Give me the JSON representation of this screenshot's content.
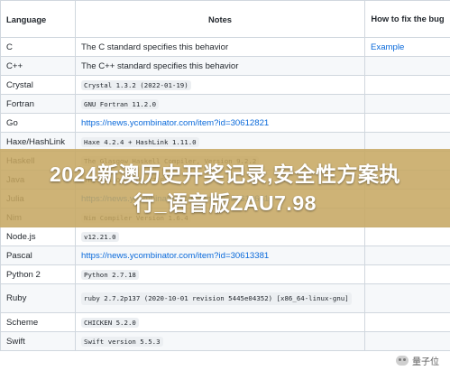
{
  "table": {
    "headers": [
      "Language",
      "Notes",
      "How to fix the bug"
    ],
    "rows": [
      {
        "language": "C",
        "notes": "The C standard specifies this behavior",
        "notes_style": "text",
        "fix": "Example"
      },
      {
        "language": "C++",
        "notes": "The C++ standard specifies this behavior",
        "notes_style": "text",
        "fix": ""
      },
      {
        "language": "Crystal",
        "notes": "Crystal 1.3.2 (2022-01-19)",
        "notes_style": "code",
        "fix": ""
      },
      {
        "language": "Fortran",
        "notes": "GNU Fortran 11.2.0",
        "notes_style": "code",
        "fix": ""
      },
      {
        "language": "Go",
        "notes": "https://news.ycombinator.com/item?id=30612821",
        "notes_style": "link",
        "fix": ""
      },
      {
        "language": "Haxe/HashLink",
        "notes": "Haxe 4.2.4 + HashLink 1.11.0",
        "notes_style": "code",
        "fix": ""
      },
      {
        "language": "Haskell",
        "notes": "The Glasgow Haskell Compiler, Version 9.2.2",
        "notes_style": "code",
        "fix": ""
      },
      {
        "language": "Java",
        "notes": "This is OpenJDK 17.0.2",
        "notes_style": "code",
        "fix": ""
      },
      {
        "language": "Julia",
        "notes": "https://news.ycombinator.com/item?id=30613661",
        "notes_style": "link",
        "fix": ""
      },
      {
        "language": "Nim",
        "notes": "Nim Compiler Version 1.6.4",
        "notes_style": "code",
        "fix": ""
      },
      {
        "language": "Node.js",
        "notes": "v12.21.0",
        "notes_style": "code",
        "fix": ""
      },
      {
        "language": "Pascal",
        "notes": "https://news.ycombinator.com/item?id=30613381",
        "notes_style": "link",
        "fix": ""
      },
      {
        "language": "Python 2",
        "notes": "Python 2.7.18",
        "notes_style": "code",
        "fix": ""
      },
      {
        "language": "Ruby",
        "notes": "ruby 2.7.2p137 (2020-10-01 revision 5445e04352) [x86_64-linux-gnu]",
        "notes_style": "code-wrap",
        "fix": ""
      },
      {
        "language": "Scheme",
        "notes": "CHICKEN 5.2.0",
        "notes_style": "code",
        "fix": ""
      },
      {
        "language": "Swift",
        "notes": "Swift version 5.5.3",
        "notes_style": "code",
        "fix": ""
      }
    ]
  },
  "banner": {
    "line1": "2024新澳历史开奖记录,安全性方案执",
    "line2": "行_语音版ZAU7.98"
  },
  "watermark": {
    "text": "量子位",
    "icon": "wechat-icon"
  },
  "colors": {
    "link": "#0969da",
    "border": "#d0d7de",
    "stripe": "#f6f8fa",
    "banner": "#c6a660"
  }
}
